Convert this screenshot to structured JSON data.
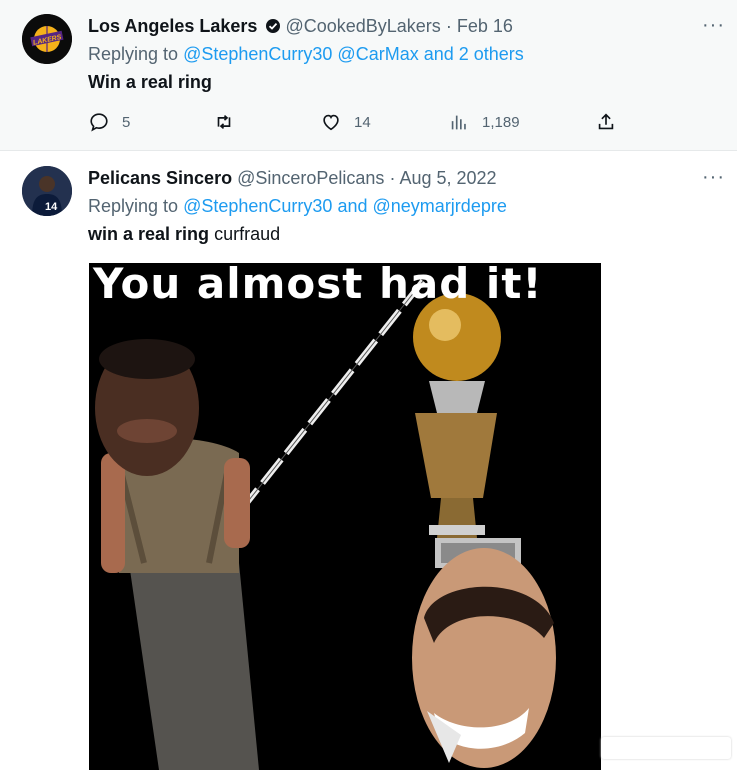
{
  "tweet1": {
    "name": "Los Angeles Lakers",
    "handle": "@CookedByLakers",
    "sep": "·",
    "date": "Feb 16",
    "replying_prefix": "Replying to",
    "mentions": "@StephenCurry30 @CarMax and 2 others",
    "text": "Win a real ring",
    "avatar_text": "LAKERS",
    "stats": {
      "replies": "5",
      "likes": "14",
      "views": "1,189"
    },
    "more": "···"
  },
  "tweet2": {
    "name": "Pelicans Sincero",
    "handle": "@SinceroPelicans",
    "sep": "·",
    "date": "Aug 5, 2022",
    "replying_prefix": "Replying to",
    "mention1": "@StephenCurry30",
    "and_word": "and",
    "mention2": "@neymarjrdepre",
    "text_bold": "win a real ring",
    "text_rest": "curfraud",
    "avatar_number": "14",
    "more": "···",
    "meme_caption": "You almost had it!"
  },
  "colors": {
    "accent": "#1d9bf0",
    "muted": "#536471",
    "text": "#0f1419",
    "lakers_gold": "#f5b11a",
    "lakers_purple": "#552583"
  },
  "icons": [
    "reply-icon",
    "retweet-icon",
    "like-icon",
    "views-icon",
    "share-icon",
    "more-icon",
    "verified-icon"
  ]
}
